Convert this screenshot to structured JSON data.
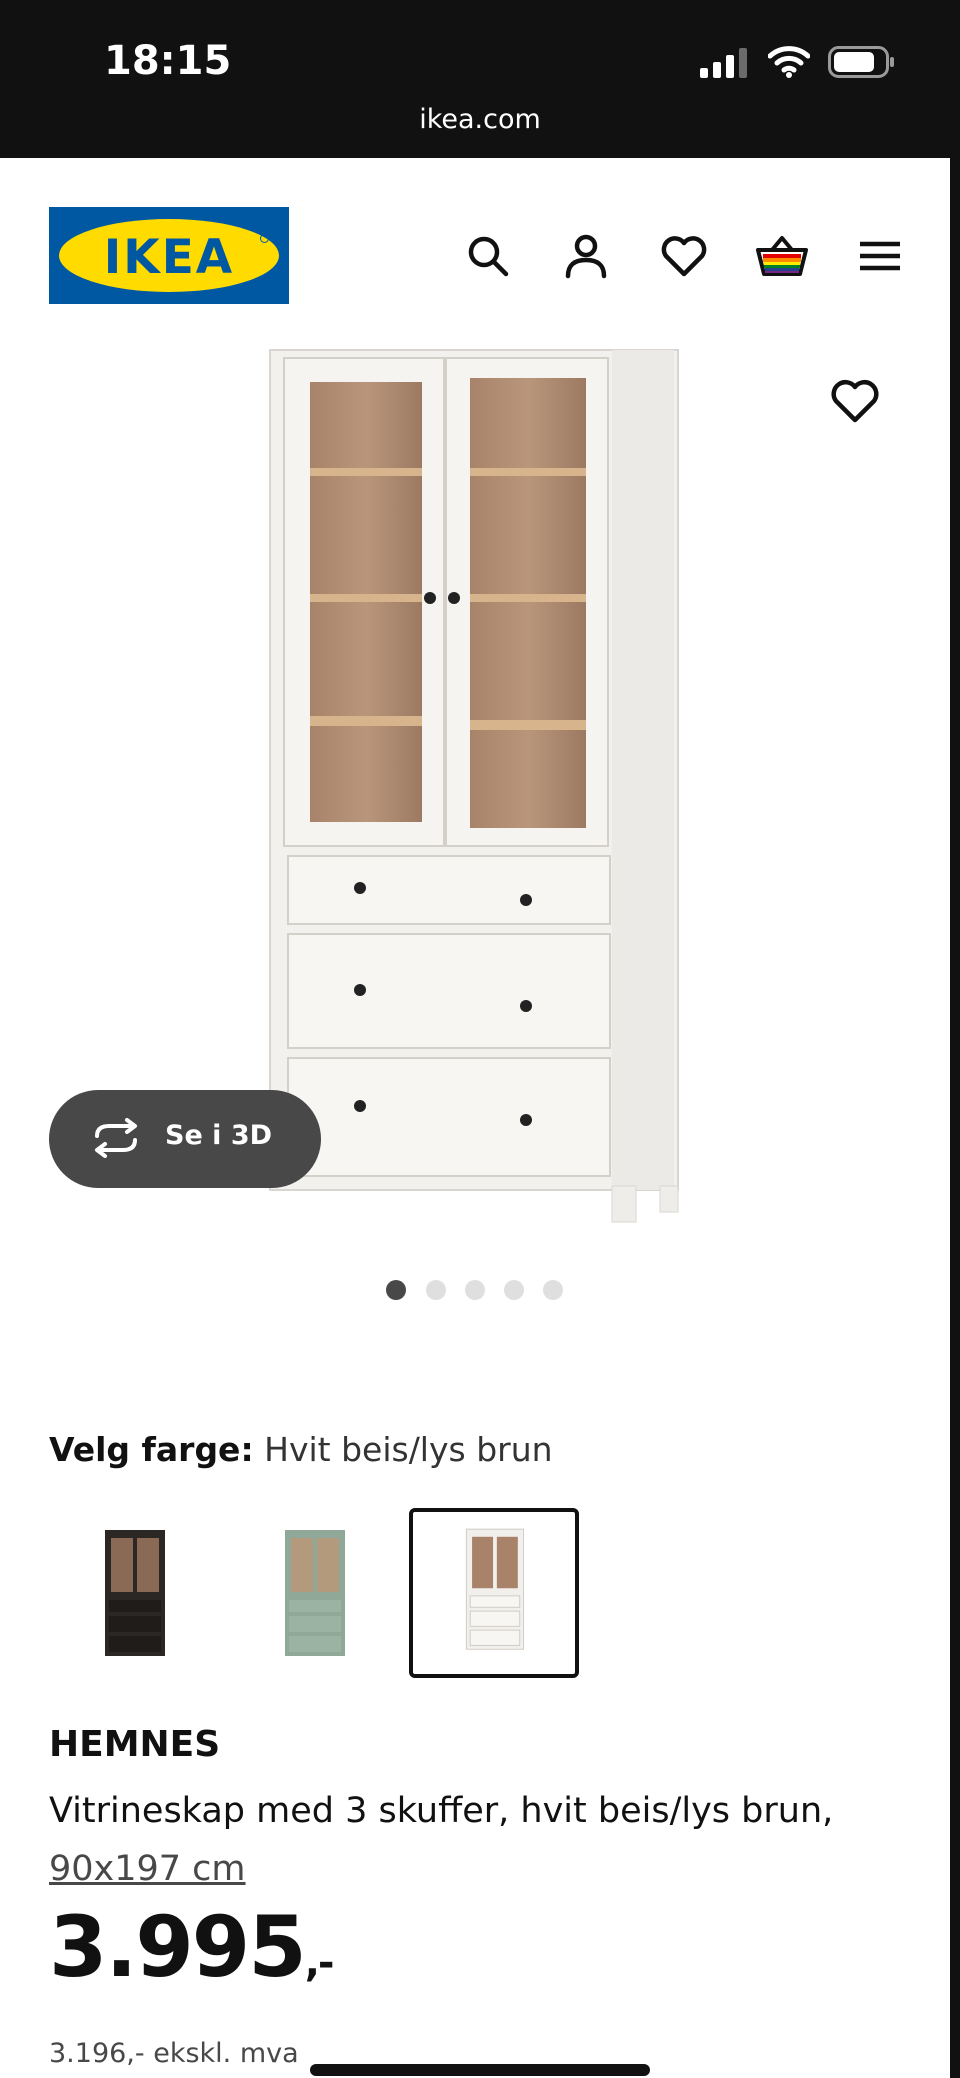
{
  "status_bar": {
    "time": "18:15",
    "url": "ikea.com"
  },
  "header": {
    "logo_text": "IKEA",
    "icons": [
      "search-icon",
      "user-icon",
      "heart-icon",
      "basket-icon",
      "menu-icon"
    ]
  },
  "gallery": {
    "view_3d_label": "Se i 3D",
    "dot_count": 5,
    "active_dot": 1
  },
  "color_selection": {
    "label": "Velg farge:",
    "selected_value": "Hvit beis/lys brun",
    "options": [
      "black-brown",
      "grey-green",
      "white-stain-light-brown"
    ],
    "selected_index": 2
  },
  "product": {
    "brand": "HEMNES",
    "description": "Vitrineskap med 3 skuffer, hvit beis/lys brun,",
    "size": "90x197 cm",
    "price": "3.995",
    "price_suffix": ",-",
    "price_ex_vat": "3.196,- ekskl. mva"
  },
  "colors": {
    "ikea_blue": "#0058a3",
    "ikea_yellow": "#ffdb00",
    "dark": "#111111",
    "grey_button": "#484848"
  }
}
